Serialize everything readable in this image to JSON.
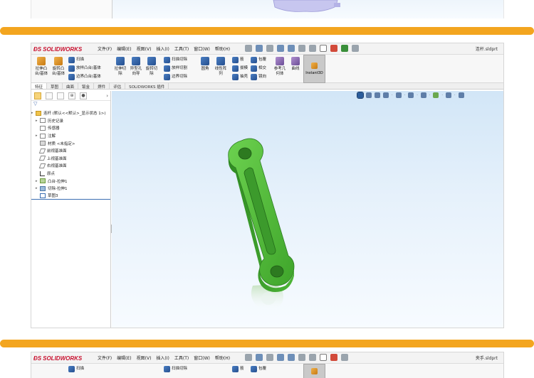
{
  "main_window": {
    "logo_text": "SOLIDWORKS",
    "menus": [
      "文件(F)",
      "编辑(E)",
      "视图(V)",
      "插入(I)",
      "工具(T)",
      "窗口(W)",
      "帮助(H)"
    ],
    "filename": "连杆.sldprt",
    "ribbon": {
      "extrude_boss": "拉伸凸\n台/基体",
      "revolve_boss": "旋转凸\n台/基体",
      "sweep": "扫描",
      "loft_boss": "放样凸台/基体",
      "boundary_boss": "边界凸台/基体",
      "extrude_cut": "拉伸切\n除",
      "hole_wizard": "异型孔\n向导",
      "revolve_cut": "旋转切\n除",
      "swept_cut": "扫描切除",
      "lofted_cut": "放样切割",
      "boundary_cut": "边界切除",
      "fillet": "圆角",
      "linear_pattern": "线性阵\n列",
      "rib": "筋",
      "draft": "拔模",
      "shell": "抽壳",
      "wrap": "包覆",
      "intersect": "相交",
      "mirror": "镜向",
      "ref_geometry": "参考几\n何体",
      "curves": "曲线",
      "instant3d": "Instant3D"
    },
    "command_tabs": [
      "特征",
      "草图",
      "曲面",
      "钣金",
      "焊件",
      "评估",
      "SOLIDWORKS 插件"
    ],
    "active_tab": "特征",
    "feature_tree": {
      "root": "连杆 (默认<<默认>_显示状态 1>)",
      "items": [
        {
          "label": "历史记录",
          "icon": "history-icon"
        },
        {
          "label": "传感器",
          "icon": "sensor-icon"
        },
        {
          "label": "注解",
          "icon": "annotation-icon"
        },
        {
          "label": "材质 <未指定>",
          "icon": "material-icon"
        },
        {
          "label": "前视基准面",
          "icon": "plane-icon"
        },
        {
          "label": "上视基准面",
          "icon": "plane-icon"
        },
        {
          "label": "右视基准面",
          "icon": "plane-icon"
        },
        {
          "label": "原点",
          "icon": "origin-icon"
        },
        {
          "label": "凸台-拉伸1",
          "icon": "extrude-icon"
        },
        {
          "label": "切除-拉伸1",
          "icon": "cut-extrude-icon"
        },
        {
          "label": "草图3",
          "icon": "sketch-icon"
        }
      ]
    }
  },
  "second_window": {
    "logo_text": "SOLIDWORKS",
    "menus": [
      "文件(F)",
      "编辑(E)",
      "视图(V)",
      "插入(I)",
      "工具(T)",
      "窗口(W)",
      "帮助(H)"
    ],
    "filename": "夹手.sldprt",
    "ribbon": {
      "sweep": "扫描",
      "swept_cut": "扫描切除",
      "rib": "筋",
      "wrap": "包覆"
    }
  },
  "colors": {
    "separator": "#f3a51f",
    "model_green": "#4fb83a",
    "brand_red": "#c8102e"
  }
}
